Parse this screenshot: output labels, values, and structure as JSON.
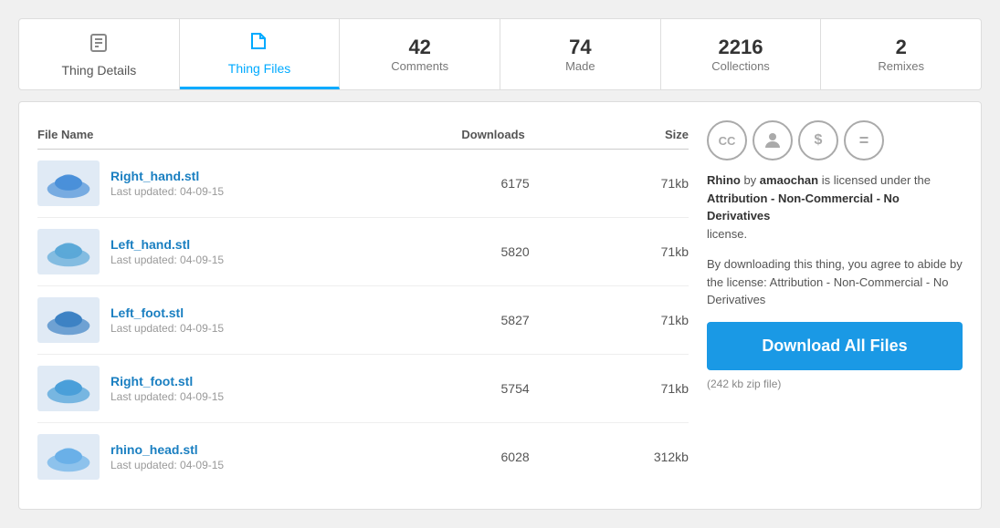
{
  "tabs": [
    {
      "id": "thing-details",
      "icon": "📋",
      "label": "Thing Details",
      "number": null,
      "sublabel": null
    },
    {
      "id": "thing-files",
      "icon": "📄",
      "label": "Thing Files",
      "number": null,
      "sublabel": null,
      "active": true
    },
    {
      "id": "comments",
      "icon": null,
      "number": "42",
      "sublabel": "Comments"
    },
    {
      "id": "made",
      "icon": null,
      "number": "74",
      "sublabel": "Made"
    },
    {
      "id": "collections",
      "icon": null,
      "number": "2216",
      "sublabel": "Collections"
    },
    {
      "id": "remixes",
      "icon": null,
      "number": "2",
      "sublabel": "Remixes"
    }
  ],
  "file_table": {
    "headers": {
      "name": "File Name",
      "downloads": "Downloads",
      "size": "Size"
    },
    "files": [
      {
        "name": "Right_hand.stl",
        "updated": "Last updated: 04-09-15",
        "downloads": "6175",
        "size": "71kb"
      },
      {
        "name": "Left_hand.stl",
        "updated": "Last updated: 04-09-15",
        "downloads": "5820",
        "size": "71kb"
      },
      {
        "name": "Left_foot.stl",
        "updated": "Last updated: 04-09-15",
        "downloads": "5827",
        "size": "71kb"
      },
      {
        "name": "Right_foot.stl",
        "updated": "Last updated: 04-09-15",
        "downloads": "5754",
        "size": "71kb"
      },
      {
        "name": "rhino_head.stl",
        "updated": "Last updated: 04-09-15",
        "downloads": "6028",
        "size": "312kb"
      }
    ]
  },
  "sidebar": {
    "license_icons": [
      "CC",
      "BY",
      "$",
      "="
    ],
    "license_text_1": "Rhino",
    "license_by": "amaochan",
    "license_text_2": "is licensed under the",
    "license_name": "Attribution - Non-Commercial - No Derivatives",
    "license_text_3": "license.",
    "download_warning": "By downloading this thing, you agree to abide by the license: Attribution - Non-Commercial - No Derivatives",
    "download_button_label": "Download All Files",
    "zip_info": "(242 kb zip file)"
  }
}
